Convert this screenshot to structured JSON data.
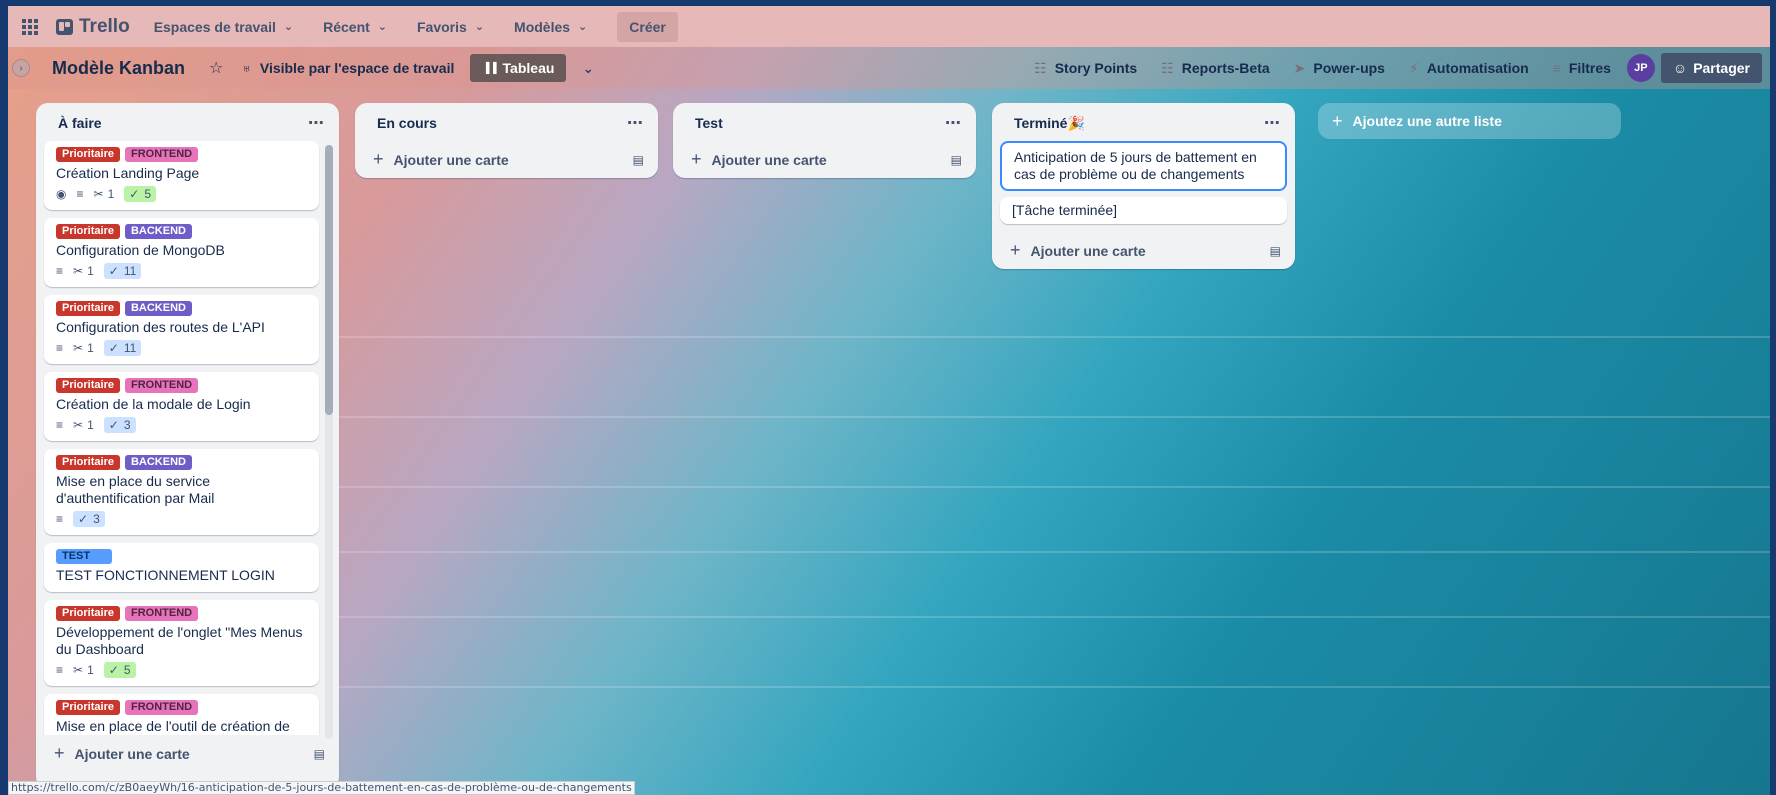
{
  "topbar": {
    "app_name": "Trello",
    "menus": [
      {
        "label": "Espaces de travail"
      },
      {
        "label": "Récent"
      },
      {
        "label": "Favoris"
      },
      {
        "label": "Modèles"
      }
    ],
    "create_label": "Créer"
  },
  "board": {
    "title": "Modèle Kanban",
    "visibility": "Visible par l'espace de travail",
    "view_label": "Tableau",
    "right": {
      "story_points": "Story Points",
      "reports": "Reports-Beta",
      "powerups": "Power-ups",
      "automation": "Automatisation",
      "filters": "Filtres",
      "avatar_initials": "JP",
      "share": "Partager"
    }
  },
  "lists": {
    "todo": {
      "title": "À faire",
      "cards": [
        {
          "labels": [
            "Prioritaire",
            "FRONTEND"
          ],
          "title": "Création Landing Page",
          "attachments": "1",
          "checklist": "5"
        },
        {
          "labels": [
            "Prioritaire",
            "BACKEND"
          ],
          "title": "Configuration de MongoDB",
          "attachments": "1",
          "checklist": "11"
        },
        {
          "labels": [
            "Prioritaire",
            "BACKEND"
          ],
          "title": "Configuration des routes de L'API",
          "attachments": "1",
          "checklist": "11"
        },
        {
          "labels": [
            "Prioritaire",
            "FRONTEND"
          ],
          "title": "Création de la modale de Login",
          "attachments": "1",
          "checklist": "3"
        },
        {
          "labels": [
            "Prioritaire",
            "BACKEND"
          ],
          "title": "Mise en place du service d'authentification par Mail",
          "checklist": "3"
        },
        {
          "labels": [
            "TEST"
          ],
          "title": "TEST FONCTIONNEMENT LOGIN"
        },
        {
          "labels": [
            "Prioritaire",
            "FRONTEND"
          ],
          "title": "Développement de l'onglet \"Mes Menus du Dashboard",
          "attachments": "1",
          "checklist": "5"
        },
        {
          "labels": [
            "Prioritaire",
            "FRONTEND"
          ],
          "title": "Mise en place de l'outil de création de menu /// DEV FRONT"
        }
      ],
      "add_label": "Ajouter une carte"
    },
    "doing": {
      "title": "En cours",
      "add_label": "Ajouter une carte"
    },
    "test": {
      "title": "Test",
      "add_label": "Ajouter une carte"
    },
    "done": {
      "title": "Terminé",
      "title_emoji": "🎉",
      "edit_card": "Anticipation de 5 jours de battement en cas de problème ou de changements",
      "card": "[Tâche terminée]",
      "add_label": "Ajouter une carte"
    },
    "add_list": "Ajoutez une autre liste"
  },
  "statusbar": {
    "url": "https://trello.com/c/zB0aeyWh/16-anticipation-de-5-jours-de-battement-en-cas-de-problème-ou-de-changements"
  },
  "colors": {
    "topbar": "#e6b8b8",
    "label_priority": "#c9372c",
    "label_frontend": "#e774bb",
    "label_backend": "#6e5dc6",
    "label_test": "#579dff",
    "share_button": "#44546f"
  }
}
